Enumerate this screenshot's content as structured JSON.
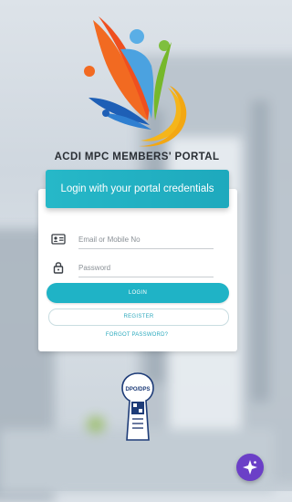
{
  "app": {
    "title": "ACDI MPC MEMBERS' PORTAL"
  },
  "login": {
    "header": "Login with your portal credentials",
    "email_placeholder": "Email or Mobile No",
    "password_placeholder": "Password",
    "login_label": "LOGIN",
    "register_label": "REGISTER",
    "forgot_label": "FORGOT PASSWORD?"
  },
  "badge": {
    "label": "DPO/DPS"
  },
  "colors": {
    "accent": "#1fb3c6",
    "fab": "#6b3fc7"
  },
  "icons": [
    "logo-icon",
    "id-card-icon",
    "lock-icon",
    "dpo-dps-badge",
    "sparkle-icon"
  ]
}
